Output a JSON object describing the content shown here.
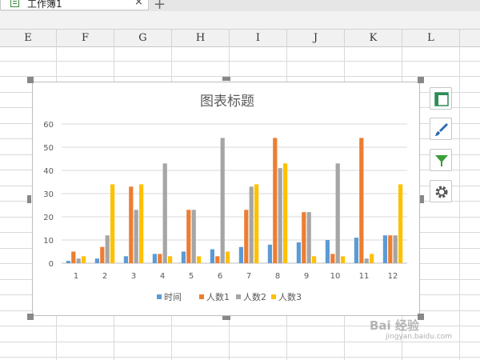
{
  "tabs": {
    "sheet_name": "工作簿1",
    "close_glyph": "×",
    "new_tab_glyph": "+"
  },
  "columns": [
    "E",
    "F",
    "G",
    "H",
    "I",
    "J",
    "K",
    "L"
  ],
  "chart_tools": {
    "icons": [
      "chart-elements-icon",
      "chart-style-icon",
      "chart-filter-icon",
      "chart-settings-icon"
    ]
  },
  "watermark": {
    "text": "Bai 经验",
    "url": "jingyan.baidu.com"
  },
  "colors": {
    "series1": "#5b9bd5",
    "series2": "#ed7d31",
    "series3": "#a5a5a5",
    "series4": "#ffc000"
  },
  "chart_data": {
    "type": "bar",
    "title": "图表标题",
    "categories": [
      "1",
      "2",
      "3",
      "4",
      "5",
      "6",
      "7",
      "8",
      "9",
      "10",
      "11",
      "12"
    ],
    "ylim": [
      0,
      60
    ],
    "yticks": [
      "0",
      "10",
      "20",
      "30",
      "40",
      "50",
      "60"
    ],
    "grid": true,
    "legend_position": "bottom",
    "series": [
      {
        "name": "时间",
        "color": "#5b9bd5",
        "values": [
          1,
          2,
          3,
          4,
          5,
          6,
          7,
          8,
          9,
          10,
          11,
          12
        ]
      },
      {
        "name": "人数1",
        "color": "#ed7d31",
        "values": [
          5,
          7,
          33,
          4,
          23,
          3,
          23,
          54,
          22,
          4,
          54,
          12
        ]
      },
      {
        "name": "人数2",
        "color": "#a5a5a5",
        "values": [
          2,
          12,
          23,
          43,
          23,
          54,
          33,
          41,
          22,
          43,
          2,
          12
        ]
      },
      {
        "name": "人数3",
        "color": "#ffc000",
        "values": [
          3,
          34,
          34,
          3,
          3,
          5,
          34,
          43,
          3,
          3,
          4,
          34
        ]
      }
    ]
  }
}
